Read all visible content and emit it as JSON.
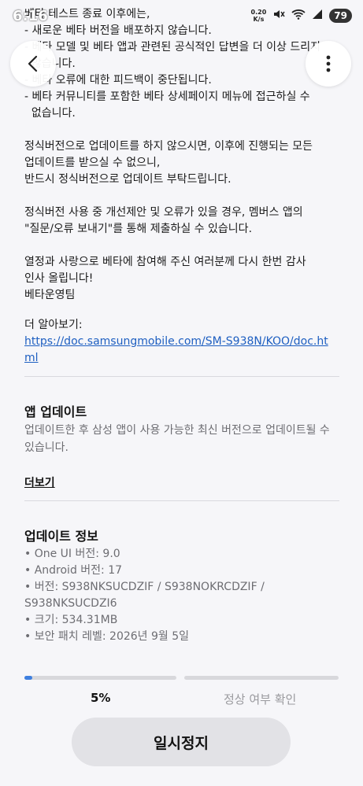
{
  "status_bar": {
    "time": "6:16",
    "speed_value": "0.20",
    "speed_unit": "K/s",
    "battery": "79",
    "icons": [
      "mute-icon",
      "wifi-icon",
      "signal-icon"
    ]
  },
  "nav": {
    "back_icon": "back-arrow-icon",
    "more_icon": "more-vertical-icon"
  },
  "notice": {
    "lines": [
      "베타 테스트 종료 이후에는,",
      "- 새로운 베타 버전을 배포하지 않습니다.",
      "- 베타 모델 및 베타 앱과 관련된 공식적인 답변을 더 이상 드리지",
      "  않습니다.",
      "- 베타 오류에 대한 피드백이 중단됩니다.",
      "- 베타 커뮤니티를 포함한 베타 상세페이지 메뉴에 접근하실 수",
      "  없습니다.",
      "",
      "정식버전으로 업데이트를 하지 않으시면, 이후에 진행되는 모든",
      "업데이트를 받으실 수 없으니,",
      "반드시 정식버전으로 업데이트 부탁드립니다.",
      "",
      "정식버전 사용 중 개선제안 및 오류가 있을 경우, 멤버스 앱의",
      "\"질문/오류 보내기\"를 통해 제출하실 수 있습니다.",
      "",
      "열정과 사랑으로 베타에 참여해 주신 여러분께 다시 한번 감사",
      "인사 올립니다!",
      "베타운영팀"
    ],
    "learn_more_label": "더 알아보기:",
    "link": "https://doc.samsungmobile.com/SM-S938N/KOO/doc.html"
  },
  "app_update": {
    "title": "앱 업데이트",
    "description": "업데이트한 후 삼성 앱이 사용 가능한 최신 버전으로 업데이트될 수 있습니다.",
    "see_more": "더보기"
  },
  "update_info": {
    "title": "업데이트 정보",
    "items": [
      "• One UI 버전: 9.0",
      "• Android 버전: 17",
      "• 버전: S938NKSUCDZIF / S938NOKRCDZIF /",
      "   S938NKSUCDZI6",
      "• 크기: 534.31MB",
      "• 보안 패치 레벨: 2026년 9월 5일"
    ]
  },
  "progress": {
    "percent_label": "5%",
    "fill_fraction": 0.05,
    "step2_label": "정상 여부 확인",
    "fill_color": "#3e7fe0",
    "track_color": "#d8d8dc"
  },
  "pause_button": {
    "label": "일시정지"
  }
}
